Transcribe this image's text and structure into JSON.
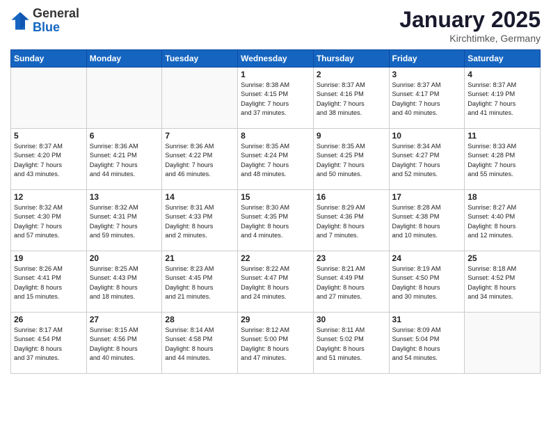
{
  "header": {
    "logo_general": "General",
    "logo_blue": "Blue",
    "month_title": "January 2025",
    "location": "Kirchtimke, Germany"
  },
  "weekdays": [
    "Sunday",
    "Monday",
    "Tuesday",
    "Wednesday",
    "Thursday",
    "Friday",
    "Saturday"
  ],
  "weeks": [
    [
      {
        "day": "",
        "info": ""
      },
      {
        "day": "",
        "info": ""
      },
      {
        "day": "",
        "info": ""
      },
      {
        "day": "1",
        "info": "Sunrise: 8:38 AM\nSunset: 4:15 PM\nDaylight: 7 hours\nand 37 minutes."
      },
      {
        "day": "2",
        "info": "Sunrise: 8:37 AM\nSunset: 4:16 PM\nDaylight: 7 hours\nand 38 minutes."
      },
      {
        "day": "3",
        "info": "Sunrise: 8:37 AM\nSunset: 4:17 PM\nDaylight: 7 hours\nand 40 minutes."
      },
      {
        "day": "4",
        "info": "Sunrise: 8:37 AM\nSunset: 4:19 PM\nDaylight: 7 hours\nand 41 minutes."
      }
    ],
    [
      {
        "day": "5",
        "info": "Sunrise: 8:37 AM\nSunset: 4:20 PM\nDaylight: 7 hours\nand 43 minutes."
      },
      {
        "day": "6",
        "info": "Sunrise: 8:36 AM\nSunset: 4:21 PM\nDaylight: 7 hours\nand 44 minutes."
      },
      {
        "day": "7",
        "info": "Sunrise: 8:36 AM\nSunset: 4:22 PM\nDaylight: 7 hours\nand 46 minutes."
      },
      {
        "day": "8",
        "info": "Sunrise: 8:35 AM\nSunset: 4:24 PM\nDaylight: 7 hours\nand 48 minutes."
      },
      {
        "day": "9",
        "info": "Sunrise: 8:35 AM\nSunset: 4:25 PM\nDaylight: 7 hours\nand 50 minutes."
      },
      {
        "day": "10",
        "info": "Sunrise: 8:34 AM\nSunset: 4:27 PM\nDaylight: 7 hours\nand 52 minutes."
      },
      {
        "day": "11",
        "info": "Sunrise: 8:33 AM\nSunset: 4:28 PM\nDaylight: 7 hours\nand 55 minutes."
      }
    ],
    [
      {
        "day": "12",
        "info": "Sunrise: 8:32 AM\nSunset: 4:30 PM\nDaylight: 7 hours\nand 57 minutes."
      },
      {
        "day": "13",
        "info": "Sunrise: 8:32 AM\nSunset: 4:31 PM\nDaylight: 7 hours\nand 59 minutes."
      },
      {
        "day": "14",
        "info": "Sunrise: 8:31 AM\nSunset: 4:33 PM\nDaylight: 8 hours\nand 2 minutes."
      },
      {
        "day": "15",
        "info": "Sunrise: 8:30 AM\nSunset: 4:35 PM\nDaylight: 8 hours\nand 4 minutes."
      },
      {
        "day": "16",
        "info": "Sunrise: 8:29 AM\nSunset: 4:36 PM\nDaylight: 8 hours\nand 7 minutes."
      },
      {
        "day": "17",
        "info": "Sunrise: 8:28 AM\nSunset: 4:38 PM\nDaylight: 8 hours\nand 10 minutes."
      },
      {
        "day": "18",
        "info": "Sunrise: 8:27 AM\nSunset: 4:40 PM\nDaylight: 8 hours\nand 12 minutes."
      }
    ],
    [
      {
        "day": "19",
        "info": "Sunrise: 8:26 AM\nSunset: 4:41 PM\nDaylight: 8 hours\nand 15 minutes."
      },
      {
        "day": "20",
        "info": "Sunrise: 8:25 AM\nSunset: 4:43 PM\nDaylight: 8 hours\nand 18 minutes."
      },
      {
        "day": "21",
        "info": "Sunrise: 8:23 AM\nSunset: 4:45 PM\nDaylight: 8 hours\nand 21 minutes."
      },
      {
        "day": "22",
        "info": "Sunrise: 8:22 AM\nSunset: 4:47 PM\nDaylight: 8 hours\nand 24 minutes."
      },
      {
        "day": "23",
        "info": "Sunrise: 8:21 AM\nSunset: 4:49 PM\nDaylight: 8 hours\nand 27 minutes."
      },
      {
        "day": "24",
        "info": "Sunrise: 8:19 AM\nSunset: 4:50 PM\nDaylight: 8 hours\nand 30 minutes."
      },
      {
        "day": "25",
        "info": "Sunrise: 8:18 AM\nSunset: 4:52 PM\nDaylight: 8 hours\nand 34 minutes."
      }
    ],
    [
      {
        "day": "26",
        "info": "Sunrise: 8:17 AM\nSunset: 4:54 PM\nDaylight: 8 hours\nand 37 minutes."
      },
      {
        "day": "27",
        "info": "Sunrise: 8:15 AM\nSunset: 4:56 PM\nDaylight: 8 hours\nand 40 minutes."
      },
      {
        "day": "28",
        "info": "Sunrise: 8:14 AM\nSunset: 4:58 PM\nDaylight: 8 hours\nand 44 minutes."
      },
      {
        "day": "29",
        "info": "Sunrise: 8:12 AM\nSunset: 5:00 PM\nDaylight: 8 hours\nand 47 minutes."
      },
      {
        "day": "30",
        "info": "Sunrise: 8:11 AM\nSunset: 5:02 PM\nDaylight: 8 hours\nand 51 minutes."
      },
      {
        "day": "31",
        "info": "Sunrise: 8:09 AM\nSunset: 5:04 PM\nDaylight: 8 hours\nand 54 minutes."
      },
      {
        "day": "",
        "info": ""
      }
    ]
  ]
}
